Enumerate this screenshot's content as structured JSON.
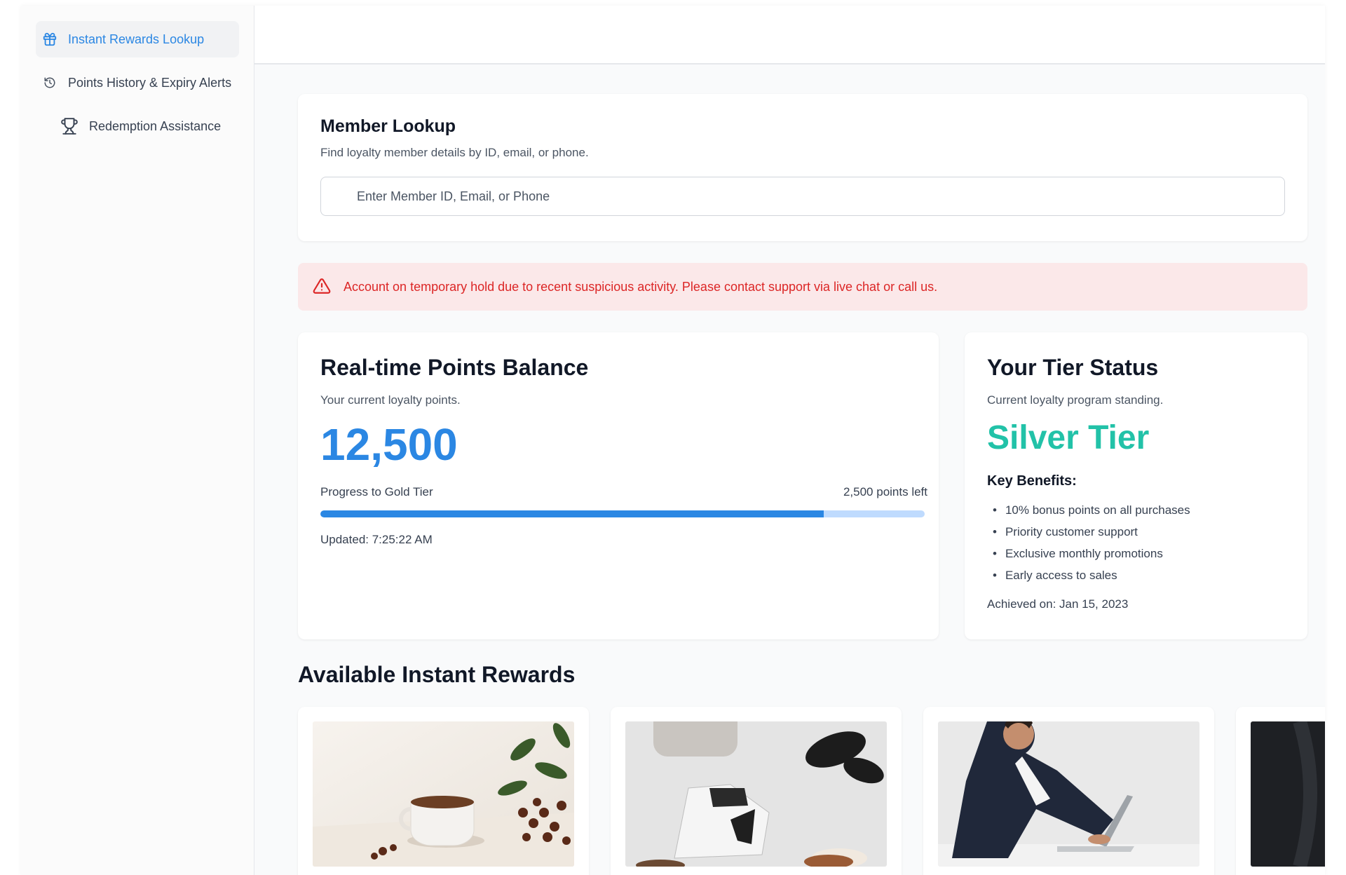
{
  "sidebar": {
    "items": [
      {
        "label": "Instant Rewards Lookup",
        "icon": "gift-icon",
        "active": true
      },
      {
        "label": "Points History & Expiry Alerts",
        "icon": "history-icon"
      },
      {
        "label": "Redemption Assistance",
        "icon": "trophy-icon"
      }
    ]
  },
  "lookup": {
    "title": "Member Lookup",
    "subtitle": "Find loyalty member details by ID, email, or phone.",
    "placeholder": "Enter Member ID, Email, or Phone",
    "value": ""
  },
  "alert": {
    "text": "Account on temporary hold due to recent suspicious activity. Please contact support via live chat or call us.",
    "icon": "warning-icon",
    "color": "#dc2626"
  },
  "points": {
    "title": "Real-time Points Balance",
    "subtitle": "Your current loyalty points.",
    "balance": "12,500",
    "progress_label": "Progress to Gold Tier",
    "points_left": "2,500 points left",
    "progress_fraction": 0.833,
    "updated": "Updated: 7:25:22 AM"
  },
  "tier": {
    "title": "Your Tier Status",
    "subtitle": "Current loyalty program standing.",
    "name": "Silver Tier",
    "benefits_heading": "Key Benefits:",
    "benefits": [
      "10% bonus points on all purchases",
      "Priority customer support",
      "Exclusive monthly promotions",
      "Early access to sales"
    ],
    "achieved": "Achieved on: Jan 15, 2023"
  },
  "rewards": {
    "title": "Available Instant Rewards",
    "items": [
      {
        "image": "coffee-cup-photo"
      },
      {
        "image": "bag-and-shoes-photo"
      },
      {
        "image": "man-with-laptop-photo"
      },
      {
        "image": "dark-product-photo"
      }
    ]
  },
  "colors": {
    "accent": "#2b87e3",
    "tier": "#22c2a8",
    "alert_bg": "#fbe8e9"
  }
}
